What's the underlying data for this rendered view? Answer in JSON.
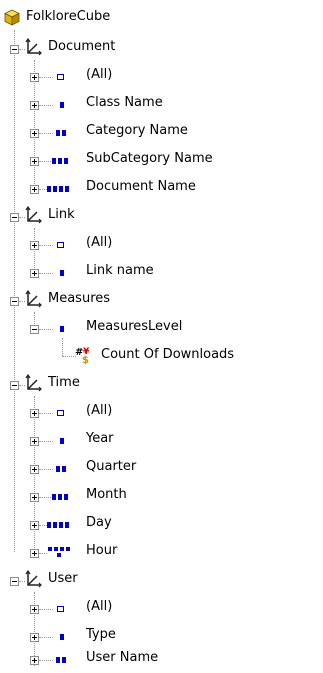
{
  "cube": {
    "label": "FolkloreCube",
    "icon": "cube-icon"
  },
  "dimensions": [
    {
      "id": "document",
      "label": "Document",
      "expanded": true,
      "levels": [
        "(All)",
        "Class Name",
        "Category Name",
        "SubCategory Name",
        "Document Name"
      ]
    },
    {
      "id": "link",
      "label": "Link",
      "expanded": true,
      "levels": [
        "(All)",
        "Link name"
      ]
    },
    {
      "id": "measures",
      "label": "Measures",
      "expanded": true,
      "levels": [
        "MeasuresLevel"
      ],
      "measure": "Count Of Downloads"
    },
    {
      "id": "time",
      "label": "Time",
      "expanded": true,
      "levels": [
        "(All)",
        "Year",
        "Quarter",
        "Month",
        "Day",
        "Hour"
      ]
    },
    {
      "id": "user",
      "label": "User",
      "expanded": true,
      "levels": [
        "(All)",
        "Type",
        "User Name"
      ]
    }
  ],
  "colors": {
    "level_icon": "#0000cc",
    "tree_line": "#9a9a9a",
    "cube_yellow": "#f2c21b"
  },
  "icons": {
    "dimension": "dimension-axes-icon",
    "level": "level-icon",
    "measure": "measure-icon"
  }
}
